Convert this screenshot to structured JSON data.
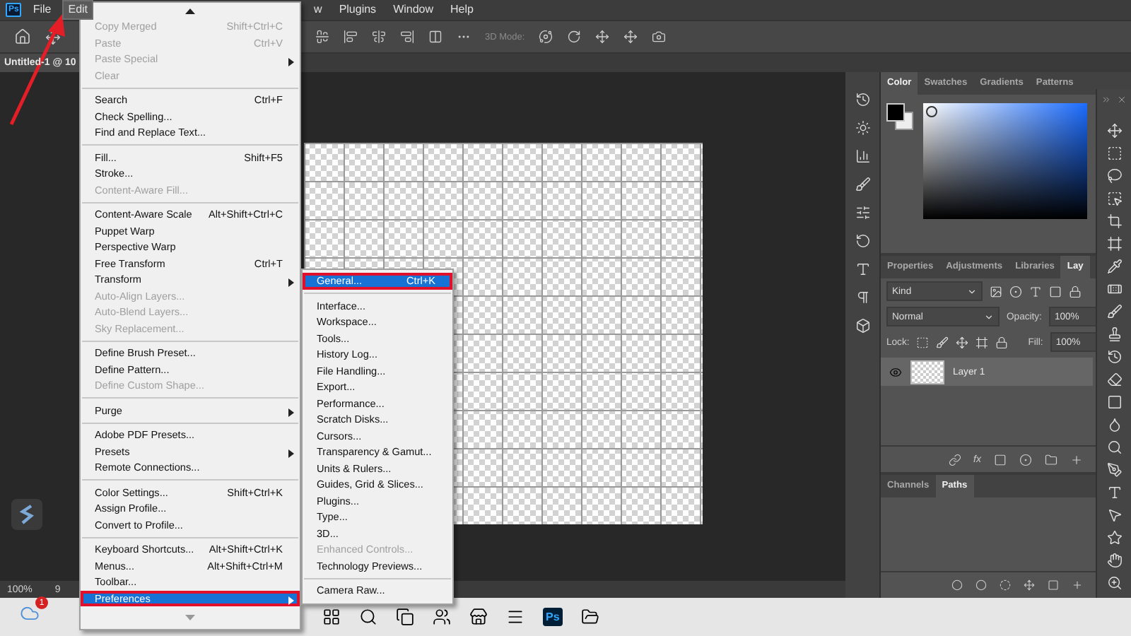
{
  "app_logo": "Ps",
  "menubar": [
    {
      "label": "File",
      "selected": false
    },
    {
      "label": "Edit",
      "selected": true
    },
    {
      "label": "w",
      "selected": false
    },
    {
      "label": "Plugins",
      "selected": false
    },
    {
      "label": "Window",
      "selected": false
    },
    {
      "label": "Help",
      "selected": false
    }
  ],
  "options_bar": {
    "mode_label": "3D Mode:"
  },
  "document_tab": {
    "title": "Untitled-1 @ 10"
  },
  "edit_menu": {
    "items": [
      {
        "kind": "item",
        "label": "Copy Merged",
        "shortcut": "Shift+Ctrl+C",
        "disabled": true,
        "submenu": false,
        "selected": false
      },
      {
        "kind": "item",
        "label": "Paste",
        "shortcut": "Ctrl+V",
        "disabled": true,
        "submenu": false,
        "selected": false
      },
      {
        "kind": "item",
        "label": "Paste Special",
        "disabled": true,
        "submenu": true,
        "selected": false
      },
      {
        "kind": "item",
        "label": "Clear",
        "disabled": true,
        "submenu": false,
        "selected": false
      },
      {
        "kind": "separator"
      },
      {
        "kind": "item",
        "label": "Search",
        "shortcut": "Ctrl+F",
        "disabled": false,
        "submenu": false,
        "selected": false
      },
      {
        "kind": "item",
        "label": "Check Spelling...",
        "disabled": false,
        "submenu": false,
        "selected": false
      },
      {
        "kind": "item",
        "label": "Find and Replace Text...",
        "disabled": false,
        "submenu": false,
        "selected": false
      },
      {
        "kind": "separator"
      },
      {
        "kind": "item",
        "label": "Fill...",
        "shortcut": "Shift+F5",
        "disabled": false,
        "submenu": false,
        "selected": false
      },
      {
        "kind": "item",
        "label": "Stroke...",
        "disabled": false,
        "submenu": false,
        "selected": false
      },
      {
        "kind": "item",
        "label": "Content-Aware Fill...",
        "disabled": true,
        "submenu": false,
        "selected": false
      },
      {
        "kind": "separator"
      },
      {
        "kind": "item",
        "label": "Content-Aware Scale",
        "shortcut": "Alt+Shift+Ctrl+C",
        "disabled": false,
        "submenu": false,
        "selected": false
      },
      {
        "kind": "item",
        "label": "Puppet Warp",
        "disabled": false,
        "submenu": false,
        "selected": false
      },
      {
        "kind": "item",
        "label": "Perspective Warp",
        "disabled": false,
        "submenu": false,
        "selected": false
      },
      {
        "kind": "item",
        "label": "Free Transform",
        "shortcut": "Ctrl+T",
        "disabled": false,
        "submenu": false,
        "selected": false
      },
      {
        "kind": "item",
        "label": "Transform",
        "disabled": false,
        "submenu": true,
        "selected": false
      },
      {
        "kind": "item",
        "label": "Auto-Align Layers...",
        "disabled": true,
        "submenu": false,
        "selected": false
      },
      {
        "kind": "item",
        "label": "Auto-Blend Layers...",
        "disabled": true,
        "submenu": false,
        "selected": false
      },
      {
        "kind": "item",
        "label": "Sky Replacement...",
        "disabled": true,
        "submenu": false,
        "selected": false
      },
      {
        "kind": "separator"
      },
      {
        "kind": "item",
        "label": "Define Brush Preset...",
        "disabled": false,
        "submenu": false,
        "selected": false
      },
      {
        "kind": "item",
        "label": "Define Pattern...",
        "disabled": false,
        "submenu": false,
        "selected": false
      },
      {
        "kind": "item",
        "label": "Define Custom Shape...",
        "disabled": true,
        "submenu": false,
        "selected": false
      },
      {
        "kind": "separator"
      },
      {
        "kind": "item",
        "label": "Purge",
        "disabled": false,
        "submenu": true,
        "selected": false
      },
      {
        "kind": "separator"
      },
      {
        "kind": "item",
        "label": "Adobe PDF Presets...",
        "disabled": false,
        "submenu": false,
        "selected": false
      },
      {
        "kind": "item",
        "label": "Presets",
        "disabled": false,
        "submenu": true,
        "selected": false
      },
      {
        "kind": "item",
        "label": "Remote Connections...",
        "disabled": false,
        "submenu": false,
        "selected": false
      },
      {
        "kind": "separator"
      },
      {
        "kind": "item",
        "label": "Color Settings...",
        "shortcut": "Shift+Ctrl+K",
        "disabled": false,
        "submenu": false,
        "selected": false
      },
      {
        "kind": "item",
        "label": "Assign Profile...",
        "disabled": false,
        "submenu": false,
        "selected": false
      },
      {
        "kind": "item",
        "label": "Convert to Profile...",
        "disabled": false,
        "submenu": false,
        "selected": false
      },
      {
        "kind": "separator"
      },
      {
        "kind": "item",
        "label": "Keyboard Shortcuts...",
        "shortcut": "Alt+Shift+Ctrl+K",
        "disabled": false,
        "submenu": false,
        "selected": false
      },
      {
        "kind": "item",
        "label": "Menus...",
        "shortcut": "Alt+Shift+Ctrl+M",
        "disabled": false,
        "submenu": false,
        "selected": false
      },
      {
        "kind": "item",
        "label": "Toolbar...",
        "disabled": false,
        "submenu": false,
        "selected": false
      },
      {
        "kind": "item",
        "label": "Preferences",
        "disabled": false,
        "submenu": true,
        "selected": true
      }
    ]
  },
  "preferences_submenu": {
    "items": [
      {
        "kind": "item",
        "label": "General...",
        "shortcut": "Ctrl+K",
        "disabled": false,
        "selected": true
      },
      {
        "kind": "separator"
      },
      {
        "kind": "item",
        "label": "Interface...",
        "disabled": false,
        "selected": false
      },
      {
        "kind": "item",
        "label": "Workspace...",
        "disabled": false,
        "selected": false
      },
      {
        "kind": "item",
        "label": "Tools...",
        "disabled": false,
        "selected": false
      },
      {
        "kind": "item",
        "label": "History Log...",
        "disabled": false,
        "selected": false
      },
      {
        "kind": "item",
        "label": "File Handling...",
        "disabled": false,
        "selected": false
      },
      {
        "kind": "item",
        "label": "Export...",
        "disabled": false,
        "selected": false
      },
      {
        "kind": "item",
        "label": "Performance...",
        "disabled": false,
        "selected": false
      },
      {
        "kind": "item",
        "label": "Scratch Disks...",
        "disabled": false,
        "selected": false
      },
      {
        "kind": "item",
        "label": "Cursors...",
        "disabled": false,
        "selected": false
      },
      {
        "kind": "item",
        "label": "Transparency & Gamut...",
        "disabled": false,
        "selected": false
      },
      {
        "kind": "item",
        "label": "Units & Rulers...",
        "disabled": false,
        "selected": false
      },
      {
        "kind": "item",
        "label": "Guides, Grid & Slices...",
        "disabled": false,
        "selected": false
      },
      {
        "kind": "item",
        "label": "Plugins...",
        "disabled": false,
        "selected": false
      },
      {
        "kind": "item",
        "label": "Type...",
        "disabled": false,
        "selected": false
      },
      {
        "kind": "item",
        "label": "3D...",
        "disabled": false,
        "selected": false
      },
      {
        "kind": "item",
        "label": "Enhanced Controls...",
        "disabled": true,
        "selected": false
      },
      {
        "kind": "item",
        "label": "Technology Previews...",
        "disabled": false,
        "selected": false
      },
      {
        "kind": "separator"
      },
      {
        "kind": "item",
        "label": "Camera Raw...",
        "disabled": false,
        "selected": false
      }
    ]
  },
  "color_panel": {
    "tabs": [
      {
        "label": "Color",
        "selected": true
      },
      {
        "label": "Swatches",
        "selected": false
      },
      {
        "label": "Gradients",
        "selected": false
      },
      {
        "label": "Patterns",
        "selected": false
      }
    ]
  },
  "layers_panel": {
    "tabs": [
      {
        "label": "Properties",
        "selected": false
      },
      {
        "label": "Adjustments",
        "selected": false
      },
      {
        "label": "Libraries",
        "selected": false
      },
      {
        "label": "Lay",
        "selected": true
      }
    ],
    "filter": "Kind",
    "blend_mode": "Normal",
    "opacity_label": "Opacity:",
    "opacity": "100%",
    "lock_label": "Lock:",
    "fill_label": "Fill:",
    "fill": "100%",
    "effects_button": "fx",
    "layers": [
      {
        "name": "Layer 1",
        "visible": true,
        "selected": true
      }
    ]
  },
  "paths_panel": {
    "tabs": [
      {
        "label": "Channels",
        "selected": false
      },
      {
        "label": "Paths",
        "selected": true
      }
    ]
  },
  "status_bar": {
    "zoom": "100%",
    "info": "9"
  },
  "taskbar": {
    "notification_count": "1",
    "ps_label": "Ps"
  }
}
